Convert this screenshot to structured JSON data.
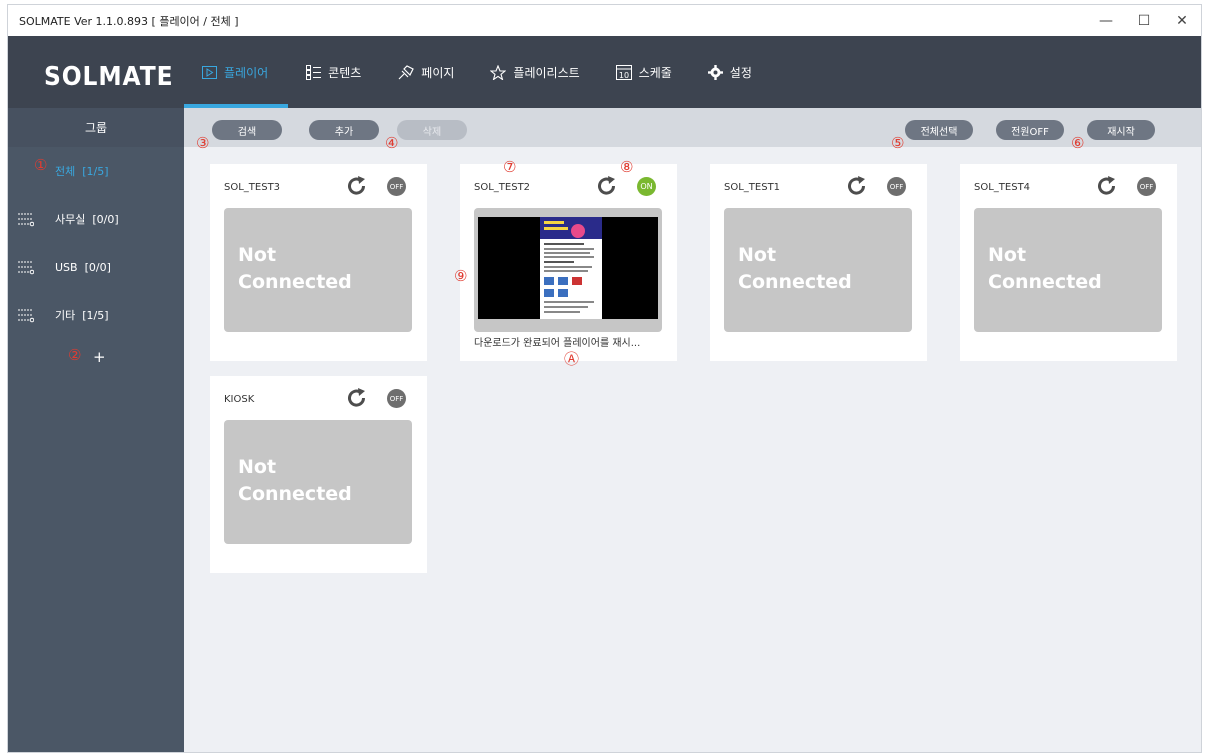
{
  "window": {
    "title": "SOLMATE Ver 1.1.0.893  [ 플레이어 / 전체 ]",
    "controls": {
      "minimize": "—",
      "maximize": "☐",
      "close": "✕"
    }
  },
  "header": {
    "logo": "SOLMATE",
    "nav": [
      {
        "label": "플레이어",
        "icon": "play-icon",
        "active": true
      },
      {
        "label": "콘텐츠",
        "icon": "list-icon"
      },
      {
        "label": "페이지",
        "icon": "pin-icon"
      },
      {
        "label": "플레이리스트",
        "icon": "star-icon"
      },
      {
        "label": "스케줄",
        "icon": "calendar-icon",
        "calendar_day": "10"
      },
      {
        "label": "설정",
        "icon": "gear-icon"
      }
    ]
  },
  "sidebar": {
    "title": "그룹",
    "groups": [
      {
        "label": "전체",
        "count": "[1/5]",
        "active": true
      },
      {
        "label": "사무실",
        "count": "[0/0]"
      },
      {
        "label": "USB",
        "count": "[0/0]"
      },
      {
        "label": "기타",
        "count": "[1/5]"
      }
    ],
    "add_label": "+"
  },
  "toolbar": {
    "search": "검색",
    "add": "추가",
    "delete": "삭제",
    "select_all": "전체선택",
    "power_off": "전원OFF",
    "restart": "재시작"
  },
  "players": [
    {
      "name": "SOL_TEST3",
      "power": "OFF",
      "online": false,
      "screen_text": "Not Connected"
    },
    {
      "name": "SOL_TEST2",
      "power": "ON",
      "online": true,
      "status": "다운로드가 완료되어 플레이어를 재시..."
    },
    {
      "name": "SOL_TEST1",
      "power": "OFF",
      "online": false,
      "screen_text": "Not Connected"
    },
    {
      "name": "SOL_TEST4",
      "power": "OFF",
      "online": false,
      "screen_text": "Not Connected"
    },
    {
      "name": "KIOSK",
      "power": "OFF",
      "online": false,
      "screen_text": "Not Connected"
    }
  ],
  "markers": {
    "m1": "①",
    "m2": "②",
    "m3": "③",
    "m4": "④",
    "m5": "⑤",
    "m6": "⑥",
    "m7": "⑦",
    "m8": "⑧",
    "m9": "⑨",
    "mA": "Ⓐ"
  },
  "colors": {
    "accent": "#39a8e0",
    "header_bg": "#3d4450",
    "sidebar_bg": "#4b5766",
    "power_on": "#7ab830",
    "power_off": "#6e6e6e",
    "marker": "#e03c31"
  }
}
